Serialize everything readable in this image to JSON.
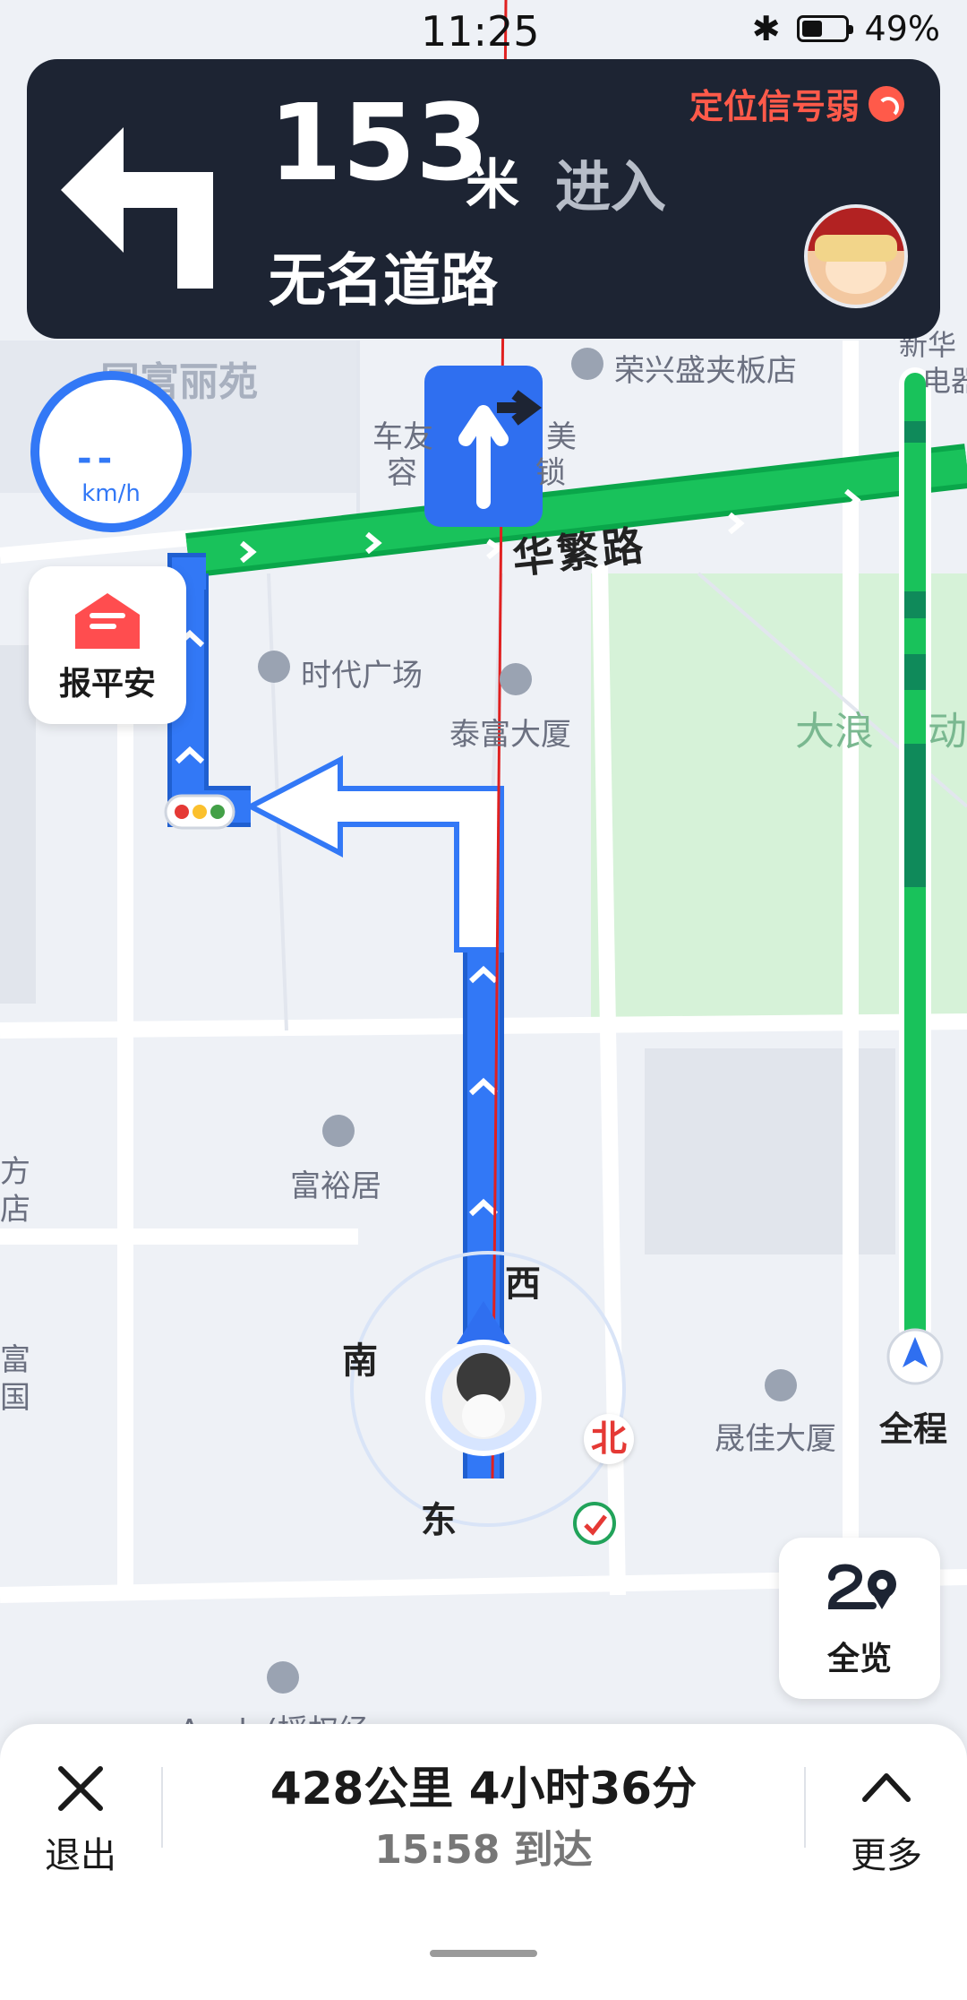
{
  "status_bar": {
    "time": "11:25",
    "battery": "49%",
    "battery_level": 0.49
  },
  "guidance": {
    "distance": "153",
    "unit": "米",
    "action": "进入",
    "road": "无名道路",
    "signal_warning": "定位信号弱"
  },
  "speed_widget": {
    "value": "--",
    "unit": "km/h"
  },
  "safe_button": {
    "label": "报平安"
  },
  "map": {
    "labels": {
      "complex": "国富丽苑",
      "shop": "荣兴盛夹板店",
      "xinhua": "新华",
      "xinhua_2": "电器",
      "car_1": "车友",
      "car_2": "容",
      "mei": "美",
      "suo": "锁",
      "street": "华繁路",
      "plaza": "时代广场",
      "taifu": "泰富大厦",
      "park": "大浪",
      "park_2": "动",
      "fuyu": "富裕居",
      "fang": "方",
      "dian": "店",
      "fu": "富",
      "guo": "国",
      "shengjia": "晟佳大厦",
      "apple": "Apple(授权经"
    },
    "compass": {
      "west": "西",
      "south": "南",
      "north": "北",
      "east": "东"
    }
  },
  "route_bar": {
    "label": "全程"
  },
  "overview_button": {
    "label": "全览"
  },
  "trip": {
    "summary": "428公里 4小时36分",
    "arrival": "15:58 到达",
    "exit_label": "退出",
    "more_label": "更多"
  },
  "colors": {
    "route": "#3278f6",
    "traffic_clear": "#19c25b",
    "card": "#1d2433",
    "warning": "#ff5a4a"
  }
}
